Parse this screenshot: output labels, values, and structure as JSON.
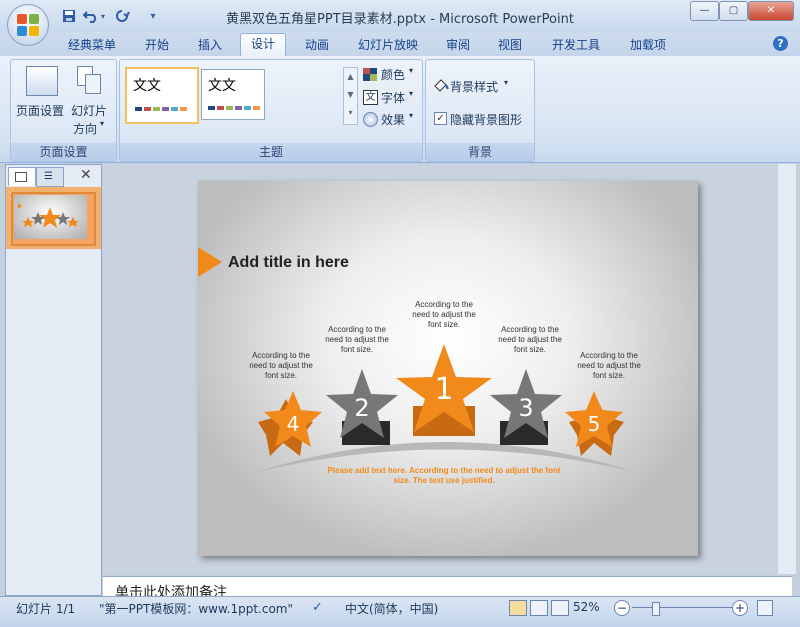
{
  "window": {
    "title": "黄黑双色五角星PPT目录素材.pptx - Microsoft PowerPoint",
    "controls": {
      "minimize": "—",
      "maximize": "▢",
      "close": "✕"
    }
  },
  "tabs": [
    {
      "label": "经典菜单"
    },
    {
      "label": "开始"
    },
    {
      "label": "插入"
    },
    {
      "label": "设计"
    },
    {
      "label": "动画"
    },
    {
      "label": "幻灯片放映"
    },
    {
      "label": "审阅"
    },
    {
      "label": "视图"
    },
    {
      "label": "开发工具"
    },
    {
      "label": "加载项"
    }
  ],
  "active_tab": "设计",
  "ribbon": {
    "page_setup": {
      "page_setup_label": "页面设置",
      "orientation_label_1": "幻灯片",
      "orientation_label_2": "方向",
      "group_label": "页面设置"
    },
    "themes": {
      "theme1_text": "文文",
      "theme2_text": "文文",
      "colors_label": "颜色",
      "fonts_label": "字体",
      "effects_label": "效果",
      "group_label": "主题"
    },
    "background": {
      "bg_style_label": "背景样式",
      "hide_bg_label": "隐藏背景图形",
      "hide_bg_checked": true,
      "group_label": "背景"
    }
  },
  "slide_pane": {
    "slide_number": "1"
  },
  "slide": {
    "title": "Add title in here",
    "stars": [
      {
        "number": "1",
        "caption": [
          "According to the",
          "need to adjust the",
          "font size."
        ]
      },
      {
        "number": "2",
        "caption": [
          "According to the",
          "need to adjust the",
          "font size."
        ]
      },
      {
        "number": "3",
        "caption": [
          "According to the",
          "need to adjust the",
          "font size."
        ]
      },
      {
        "number": "4",
        "caption": [
          "According to the",
          "need to adjust the",
          "font size."
        ]
      },
      {
        "number": "5",
        "caption": [
          "According to the",
          "need to adjust the",
          "font size."
        ]
      }
    ],
    "footer_line1": "Please add text here. According to the need to adjust the font",
    "footer_line2": "size. The text use justified.",
    "colors": {
      "orange": "#f28a1b",
      "grey": "#7a7a7a",
      "dark": "#333333"
    }
  },
  "notes": {
    "placeholder": "单击此处添加备注"
  },
  "status": {
    "slide_info": "幻灯片 1/1",
    "theme_name": "\"第一PPT模板网：www.1ppt.com\"",
    "language": "中文(简体，中国)",
    "zoom": "52%",
    "zoom_level_percent": 52
  }
}
